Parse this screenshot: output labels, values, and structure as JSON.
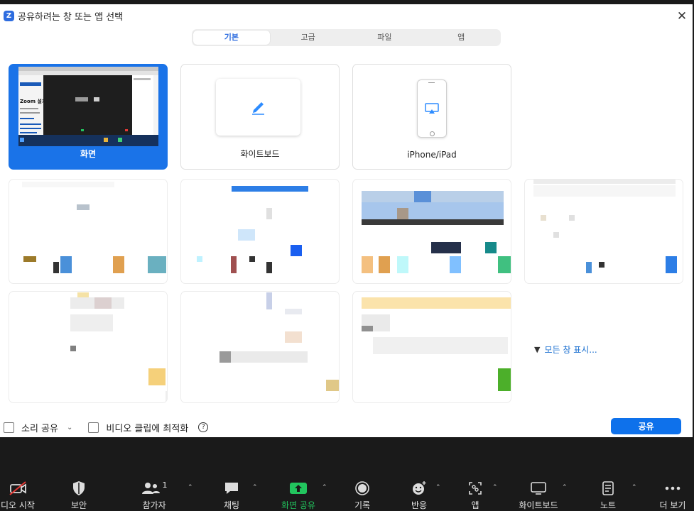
{
  "dialog": {
    "title": "공유하려는 창 또는 앱 선택",
    "close_label": "✕"
  },
  "tabs": [
    {
      "label": "기본",
      "active": true
    },
    {
      "label": "고급",
      "active": false
    },
    {
      "label": "파일",
      "active": false
    },
    {
      "label": "앱",
      "active": false
    }
  ],
  "share_options": {
    "screen": {
      "label": "화면",
      "thumb_text": "Zoom 설치",
      "selected": true
    },
    "whiteboard": {
      "label": "화이트보드",
      "icon": "pen-icon"
    },
    "iphone": {
      "label": "iPhone/iPad",
      "icon": "airplay-icon"
    }
  },
  "show_all": {
    "label": "모든 창 표시..."
  },
  "options": {
    "share_sound": {
      "label": "소리 공유",
      "checked": false
    },
    "optimize_video": {
      "label": "비디오 클립에 최적화",
      "checked": false
    },
    "help_symbol": "?"
  },
  "share_button": {
    "label": "공유"
  },
  "toolbar": {
    "video": {
      "label": "디오 시작",
      "icon": "video-off-icon"
    },
    "security": {
      "label": "보안",
      "icon": "shield-icon"
    },
    "participants": {
      "label": "참가자",
      "count": "1",
      "icon": "participants-icon"
    },
    "chat": {
      "label": "채팅",
      "icon": "chat-icon"
    },
    "share_screen": {
      "label": "화면 공유",
      "icon": "share-screen-icon"
    },
    "record": {
      "label": "기록",
      "icon": "record-icon"
    },
    "reactions": {
      "label": "반응",
      "icon": "reaction-icon"
    },
    "apps": {
      "label": "앱",
      "icon": "apps-icon"
    },
    "whiteboard": {
      "label": "화이트보드",
      "icon": "whiteboard-icon"
    },
    "notes": {
      "label": "노트",
      "icon": "notes-icon"
    },
    "more": {
      "label": "더 보기",
      "icon": "more-icon"
    },
    "caret": "⌃"
  },
  "colors": {
    "accent": "#0e71eb",
    "selected_card": "#1a73e8",
    "share_green": "#22c55e",
    "toolbar_bg": "#1a1a1a"
  }
}
